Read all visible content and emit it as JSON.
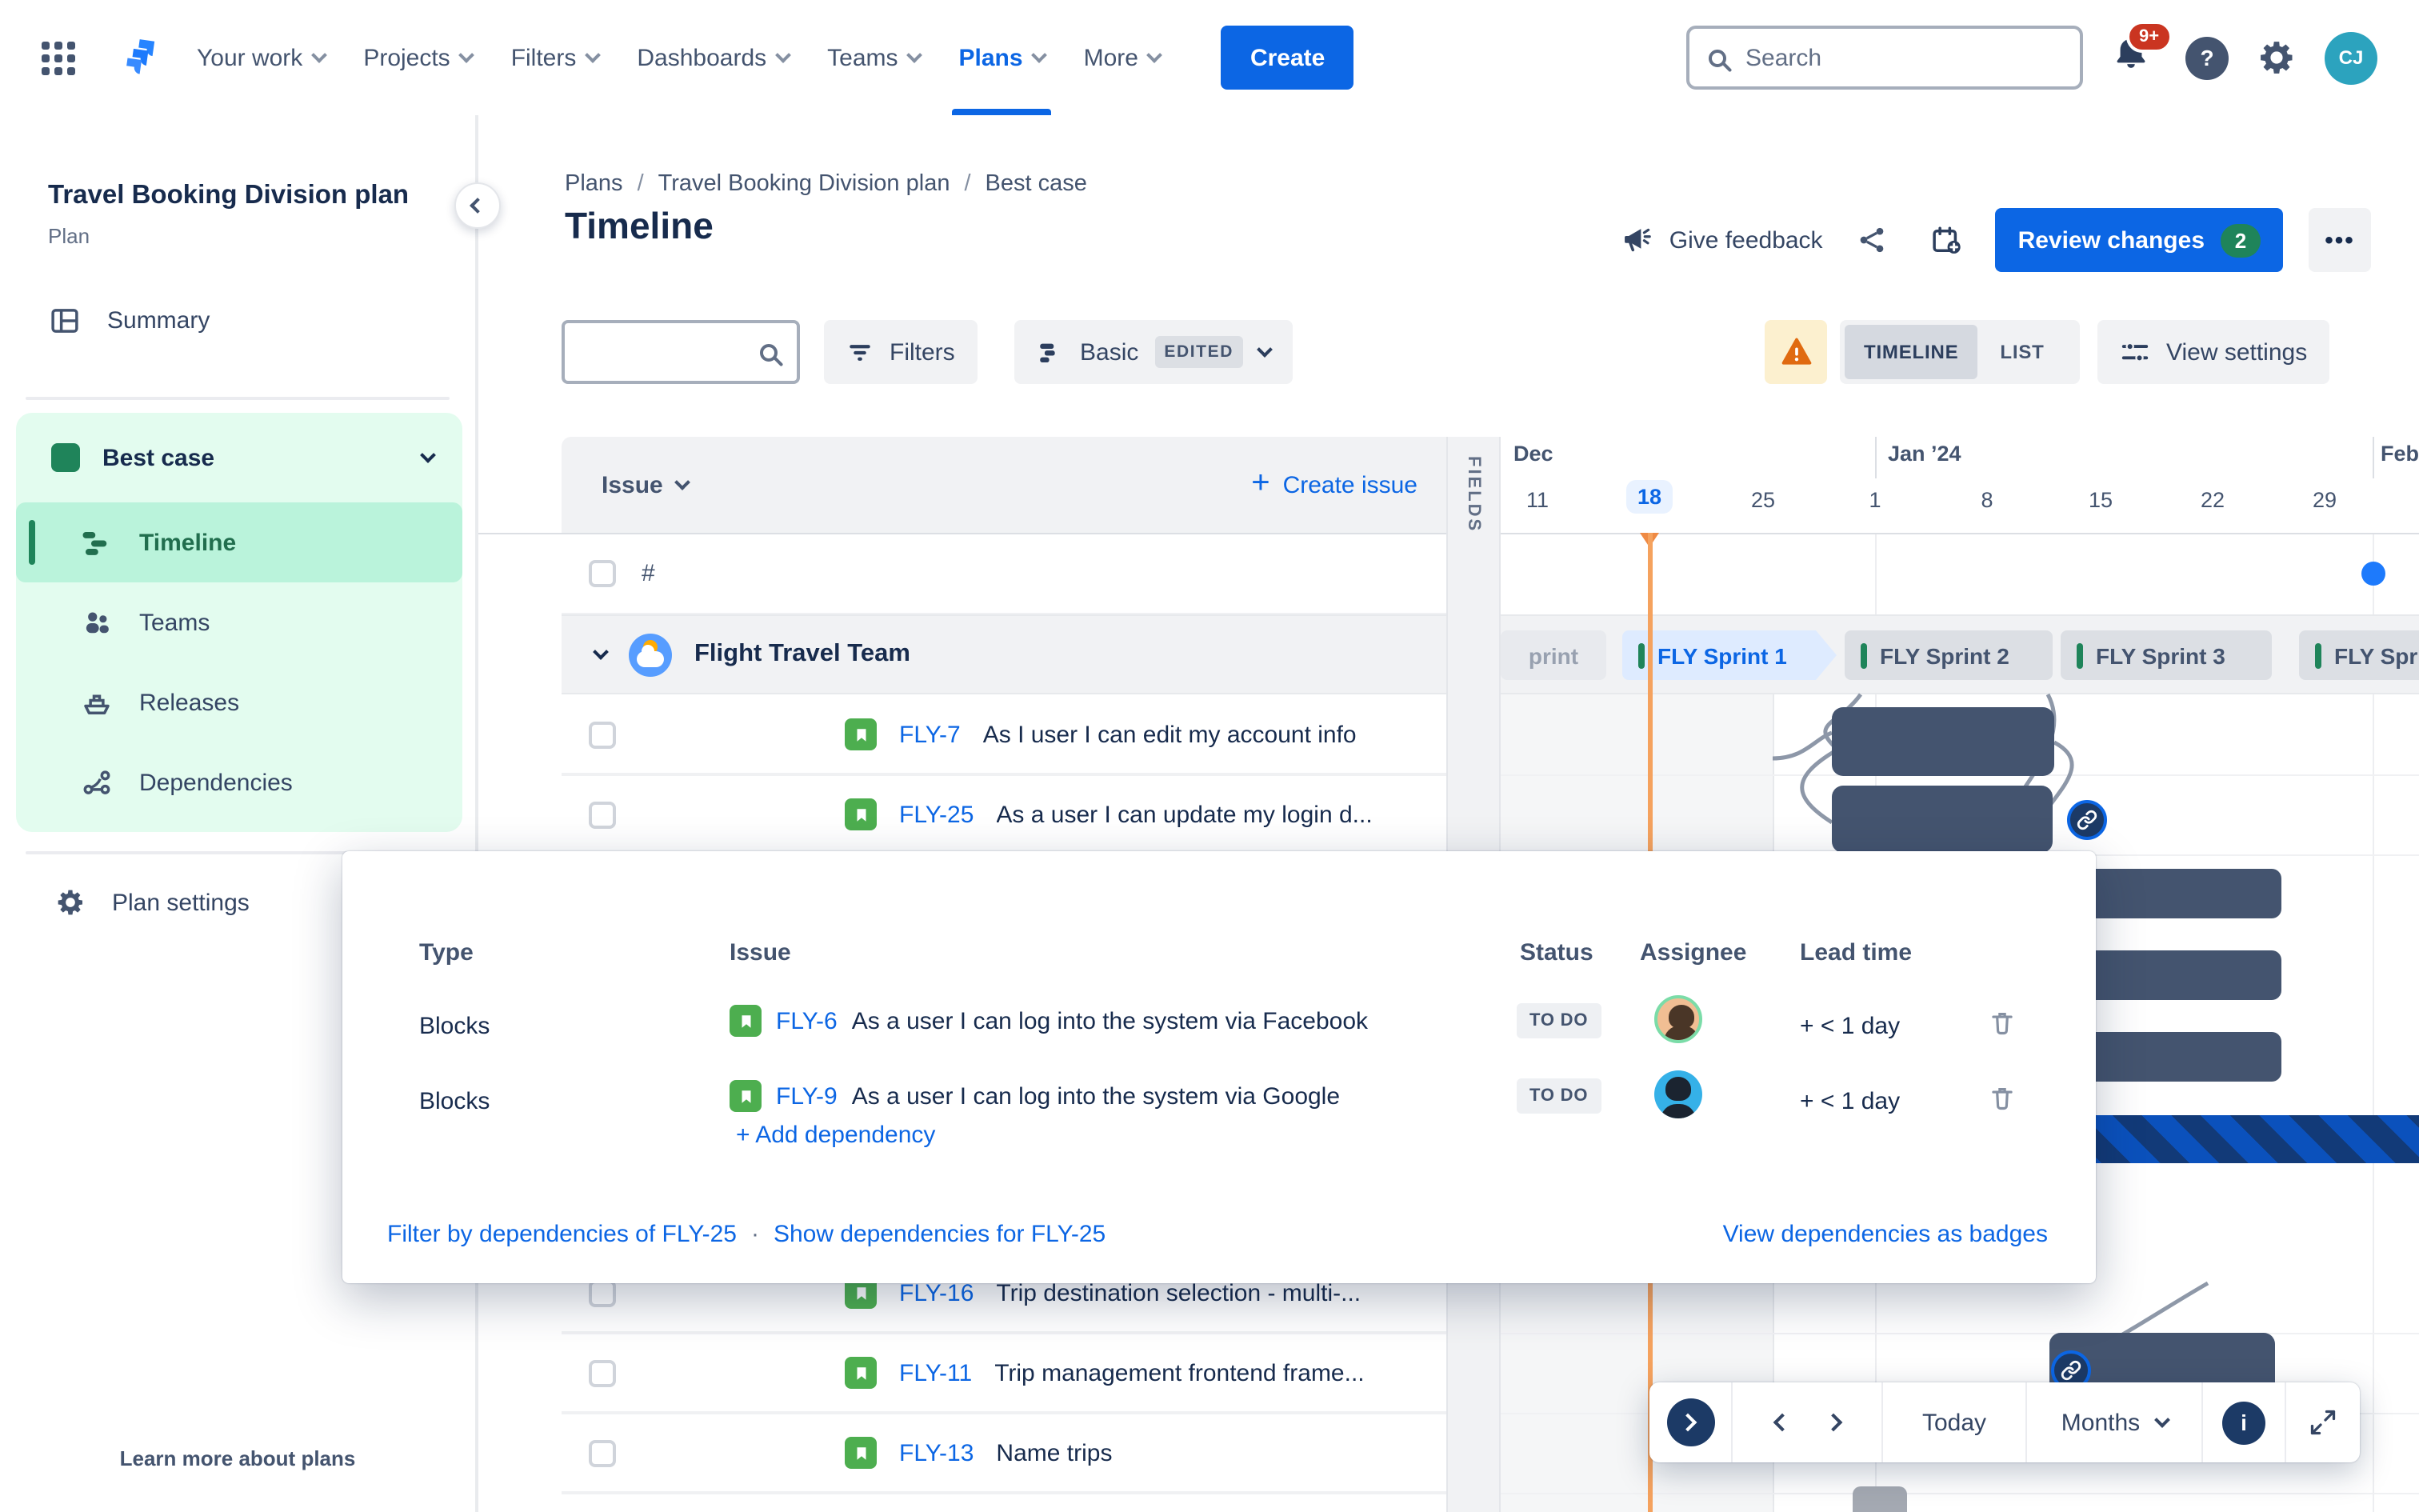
{
  "nav": {
    "menu": [
      {
        "label": "Your work"
      },
      {
        "label": "Projects"
      },
      {
        "label": "Filters"
      },
      {
        "label": "Dashboards"
      },
      {
        "label": "Teams"
      },
      {
        "label": "Plans"
      },
      {
        "label": "More"
      }
    ],
    "create_label": "Create",
    "search_placeholder": "Search",
    "notifications_badge": "9+",
    "avatar_initials": "CJ"
  },
  "sidebar": {
    "plan_title": "Travel Booking Division plan",
    "plan_type": "Plan",
    "summary_label": "Summary",
    "scenario_label": "Best case",
    "nav_items": [
      {
        "label": "Timeline"
      },
      {
        "label": "Teams"
      },
      {
        "label": "Releases"
      },
      {
        "label": "Dependencies"
      }
    ],
    "plan_settings_label": "Plan settings",
    "learn_more_label": "Learn more about plans"
  },
  "header": {
    "breadcrumb": [
      "Plans",
      "Travel Booking Division plan",
      "Best case"
    ],
    "title": "Timeline",
    "give_feedback_label": "Give feedback",
    "review_changes_label": "Review changes",
    "review_changes_count": "2"
  },
  "toolbar": {
    "filters_label": "Filters",
    "view_name": "Basic",
    "edited_badge": "EDITED",
    "timeline_toggle": "TIMELINE",
    "list_toggle": "LIST",
    "view_settings_label": "View settings"
  },
  "table": {
    "issue_column": "Issue",
    "create_issue_label": "Create issue",
    "fields_tab": "FIELDS",
    "numbering_cell": "#"
  },
  "timeline": {
    "months": [
      {
        "label": "Dec"
      },
      {
        "label": "Jan ’24"
      },
      {
        "label": "Feb"
      }
    ],
    "dates": [
      "11",
      "18",
      "25",
      "1",
      "8",
      "15",
      "22",
      "29"
    ],
    "today_date": "18",
    "sprints": [
      {
        "label": "print"
      },
      {
        "label": "FLY Sprint 1"
      },
      {
        "label": "FLY Sprint 2"
      },
      {
        "label": "FLY Sprint 3"
      },
      {
        "label": "FLY Sprin"
      }
    ]
  },
  "group": {
    "team_name": "Flight Travel Team"
  },
  "issues": [
    {
      "key": "FLY-7",
      "summary": "As I user I can edit my account info"
    },
    {
      "key": "FLY-25",
      "summary": "As a user I can update my login d..."
    },
    {
      "key": "FLY-16",
      "summary": "Trip destination selection - multi-..."
    },
    {
      "key": "FLY-11",
      "summary": "Trip management frontend frame..."
    },
    {
      "key": "FLY-13",
      "summary": "Name trips"
    }
  ],
  "dependency_popup": {
    "columns": [
      "Type",
      "Issue",
      "Status",
      "Assignee",
      "Lead time"
    ],
    "rows": [
      {
        "type": "Blocks",
        "key": "FLY-6",
        "summary": "As a user I can log into the system via Facebook",
        "status": "TO DO",
        "lead_time": "+ < 1 day"
      },
      {
        "type": "Blocks",
        "key": "FLY-9",
        "summary": "As a user I can log into the system via Google",
        "status": "TO DO",
        "lead_time": "+ < 1 day"
      }
    ],
    "add_dependency_label": "+ Add dependency",
    "filter_link": "Filter by dependencies of FLY-25",
    "dot_separator": "·",
    "show_link": "Show dependencies for FLY-25",
    "view_badges_link": "View dependencies as badges"
  },
  "controls": {
    "today_label": "Today",
    "zoom_label": "Months"
  },
  "colors": {
    "accent_blue": "#0C66E4",
    "bar_slate": "#44546F",
    "today_orange": "#F5A25E",
    "selected_green_bg": "#BAF3DB",
    "scenario_green": "#1F845A",
    "stripe_dark": "#123A78",
    "stripe_light": "#0B51BC"
  }
}
